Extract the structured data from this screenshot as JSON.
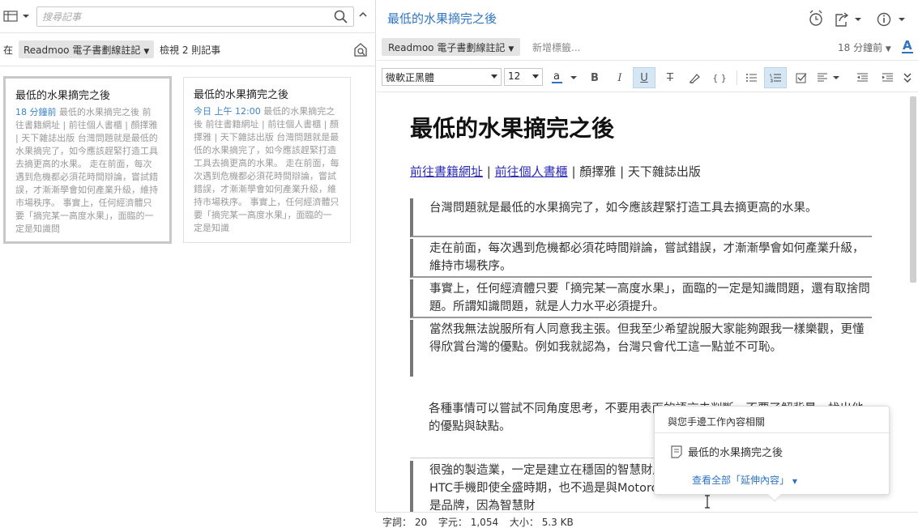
{
  "left_pane": {
    "search_placeholder": "搜尋記事",
    "filter_in_label": "在",
    "filter_notebook": "Readmoo 電子書劃線註記",
    "filter_count": "檢視 2 則記事",
    "cards": [
      {
        "title": "最低的水果摘完之後",
        "date": "18 分鐘前",
        "snippet": "最低的水果摘完之後 前往書籍網址 | 前往個人書櫃 | 顏擇雅 | 天下雜誌出版 台灣問題就是最低的水果摘完了，如今應該趕緊打造工具去摘更高的水果。 走在前面，每次遇到危機都必須花時間辯論，嘗試錯誤，才漸漸學會如何產業升級，維持市場秩序。 事實上，任何經濟體只要「摘完某一高度水果」，面臨的一定是知識問",
        "selected": true
      },
      {
        "title": "最低的水果摘完之後",
        "date": "今日 上午 12:00",
        "snippet": "最低的水果摘完之後 前往書籍網址 | 前往個人書櫃 | 顏擇雅 | 天下雜誌出版 台灣問題就是最低的水果摘完了，如今應該趕緊打造工具去摘更高的水果。 走在前面，每次遇到危機都必須花時間辯論，嘗試錯誤，才漸漸學會如何產業升級，維持市場秩序。 事實上，任何經濟體只要「摘完某一高度水果」，面臨的一定是知識",
        "selected": false
      }
    ]
  },
  "note": {
    "title": "最低的水果摘完之後",
    "notebook": "Readmoo 電子書劃線註記",
    "add_tag": "新增標籤...",
    "modified": "18 分鐘前",
    "font": "微軟正黑體",
    "font_size": "12",
    "heading": "最低的水果摘完之後",
    "link_book": "前往書籍網址",
    "link_shelf": "前往個人書櫃",
    "sep": "|",
    "author": "顏擇雅",
    "publisher": "天下雜誌出版",
    "quotes": [
      "台灣問題就是最低的水果摘完了，如今應該趕緊打造工具去摘更高的水果。",
      "走在前面，每次遇到危機都必須花時間辯論，嘗試錯誤，才漸漸學會如何產業升級，維持市場秩序。",
      "事實上，任何經濟體只要「摘完某一高度水果」，面臨的一定是知識問題，還有取捨問題。所謂知識問題，就是人力水平必須提升。",
      "當然我無法說服所有人同意我主張。但我至少希望說服大家能夠跟我一樣樂觀，更懂得欣賞台灣的優點。例如我就認為，台灣只會代工這一點並不可恥。"
    ],
    "paragraph": "各種事情可以嘗試不同角度思考，不要用表面的語言去判斷，不要了解背景，找出他的優點與缺點。",
    "quote_last": "很強的製造業，一定是建立在穩固的智慧財產權上，歐美各國都是專利大戶。相反的HTC手機即使全盛時期，也不過是與Motorola賣掉手機部門，賣的其實是智慧財而不是品牌，因為智慧財"
  },
  "related_popup": {
    "header": "與您手邊工作內容相關",
    "item": "最低的水果摘完之後",
    "view_all": "查看全部「延伸內容」"
  },
  "status_bar": {
    "words": "字詞： 20",
    "chars": "字元： 1,054",
    "size": "大小： 5.3 KB"
  }
}
